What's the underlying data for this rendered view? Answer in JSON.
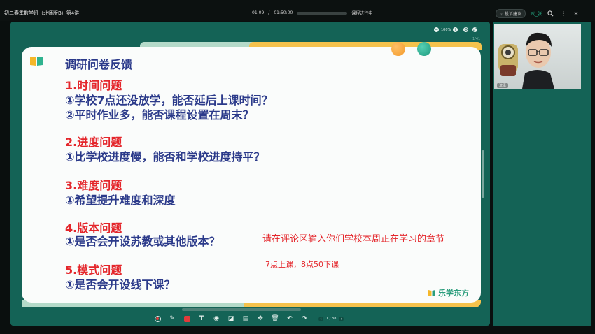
{
  "topbar": {
    "course_title": "初二春季数学班（北师版B）第4讲",
    "elapsed": "01:09",
    "total": "01:50:00",
    "progress": 0.01,
    "status": "课程进行中",
    "report_button": "投诉建议",
    "assistant_label": "助_张",
    "icons": [
      "report-icon",
      "search-zoom-icon",
      "more-icon",
      "close-icon"
    ]
  },
  "stage": {
    "zoom": "100%",
    "page_indicator": "1/41"
  },
  "slide": {
    "title": "调研问卷反馈",
    "sections": [
      {
        "heading": "1.时间问题",
        "items": [
          "①学校7点还没放学，能否延后上课时间？",
          "②平时作业多，能否课程设置在周末？"
        ]
      },
      {
        "heading": "2.进度问题",
        "items": [
          "①比学校进度慢，能否和学校进度持平？"
        ]
      },
      {
        "heading": "3.难度问题",
        "items": [
          "①希望提升难度和深度"
        ]
      },
      {
        "heading": "4.版本问题",
        "items": [
          "①是否会开设苏教或其他版本？"
        ]
      },
      {
        "heading": "5.模式问题",
        "items": [
          "①是否会开设线下课？"
        ]
      }
    ],
    "prompt_text": "请在评论区输入你们学校本周正在学习的章节",
    "comment_text": "7点上课，8点50下课",
    "logo_text": "乐学东方"
  },
  "toolbar": {
    "tools": [
      "record-icon",
      "pen-icon",
      "color-icon",
      "text-icon",
      "shape-icon",
      "eraser-icon",
      "save-icon",
      "move-icon",
      "delete-icon",
      "undo-icon",
      "redo-icon"
    ],
    "page_current": "1",
    "page_total": "38",
    "page_label": "1 / 38"
  },
  "camera": {
    "name": "沈泽"
  },
  "colors": {
    "stage": "#146356",
    "title_blue": "#2b3a8a",
    "heading_red": "#e4262b",
    "accent_yellow": "#f5c24c",
    "brand_green": "#2a9d7c"
  }
}
